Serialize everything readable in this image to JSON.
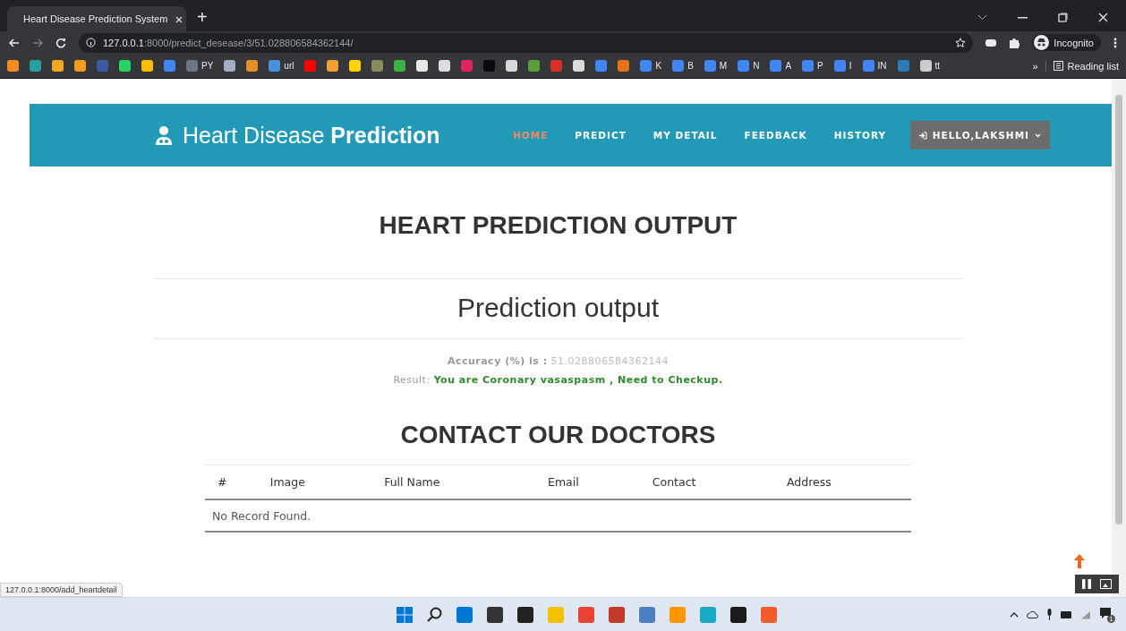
{
  "browser": {
    "tab": {
      "title": "Heart Disease Prediction System",
      "close": "×"
    },
    "new_tab": "+",
    "url": {
      "host": "127.0.0.1",
      "rest": ":8000/predict_desease/3/51.028806584362144/"
    },
    "profile": "Incognito",
    "bookmarks": [
      {
        "color": "#f08a24"
      },
      {
        "color": "#29a0a0"
      },
      {
        "color": "#f5a623"
      },
      {
        "color": "#f59b23"
      },
      {
        "color": "#3a5ba0"
      },
      {
        "color": "#25d366"
      },
      {
        "color": "#fbbc04"
      },
      {
        "color": "#4285f4"
      },
      {
        "color": "#6e7681",
        "label": "PY"
      },
      {
        "color": "#a0aec0"
      },
      {
        "color": "#e58e26"
      },
      {
        "color": "#4a90d9",
        "label": "url"
      },
      {
        "color": "#ff0000"
      },
      {
        "color": "#f0a030"
      },
      {
        "color": "#ffd400"
      },
      {
        "color": "#8a8a5a"
      },
      {
        "color": "#3cb043"
      },
      {
        "color": "#e8e8e8"
      },
      {
        "color": "#dddddd"
      },
      {
        "color": "#e0245e"
      },
      {
        "color": "#0a0a0a"
      },
      {
        "color": "#d8d8d8"
      },
      {
        "color": "#5a9e3a"
      },
      {
        "color": "#d93025"
      },
      {
        "color": "#dadada"
      },
      {
        "color": "#4285f4"
      },
      {
        "color": "#e8711a"
      },
      {
        "color": "#4285f4",
        "label": "K"
      },
      {
        "color": "#4285f4",
        "label": "B"
      },
      {
        "color": "#4285f4",
        "label": "M"
      },
      {
        "color": "#4285f4",
        "label": "N"
      },
      {
        "color": "#4285f4",
        "label": "A"
      },
      {
        "color": "#4285f4",
        "label": "P"
      },
      {
        "color": "#4285f4",
        "label": "I"
      },
      {
        "color": "#4285f4",
        "label": "IN"
      },
      {
        "color": "#2b7bb9"
      },
      {
        "color": "#cccccc",
        "label": "tt"
      }
    ],
    "more": "»",
    "reading_list": "Reading list"
  },
  "nav": {
    "brand": {
      "light": "Heart Disease",
      "bold": "Prediction"
    },
    "links": [
      {
        "label": "HOME",
        "selected": true
      },
      {
        "label": "PREDICT",
        "selected": false
      },
      {
        "label": "MY DETAIL",
        "selected": false
      },
      {
        "label": "FEEDBACK",
        "selected": false
      },
      {
        "label": "HISTORY",
        "selected": false
      }
    ],
    "user_button": "HELLO,LAKSHMI"
  },
  "page": {
    "title": "HEART PREDICTION OUTPUT",
    "subtitle": "Prediction output",
    "accuracy": {
      "label": "Accuracy (%) is :",
      "value": "51.028806584362144"
    },
    "result": {
      "label": "Result:",
      "value": "You are Coronary vasaspasm , Need to Checkup."
    },
    "contact_title": "CONTACT OUR DOCTORS",
    "table": {
      "columns": [
        "#",
        "Image",
        "Full Name",
        "Email",
        "Contact",
        "Address"
      ],
      "empty": "No Record Found."
    }
  },
  "status_url": "127.0.0.1:8000/add_heartdetail",
  "taskbar": {
    "apps": [
      {
        "color": "#0078d4"
      },
      {
        "color": "#333333"
      },
      {
        "color": "#222222"
      },
      {
        "color": "#f2c200"
      },
      {
        "color": "#e94235"
      },
      {
        "color": "#c0392b"
      },
      {
        "color": "#4a7fc1"
      },
      {
        "color": "#ff9800"
      },
      {
        "color": "#1ba9c8"
      },
      {
        "color": "#1a1a1a"
      },
      {
        "color": "#f25c2a"
      }
    ],
    "notifications": "1"
  }
}
